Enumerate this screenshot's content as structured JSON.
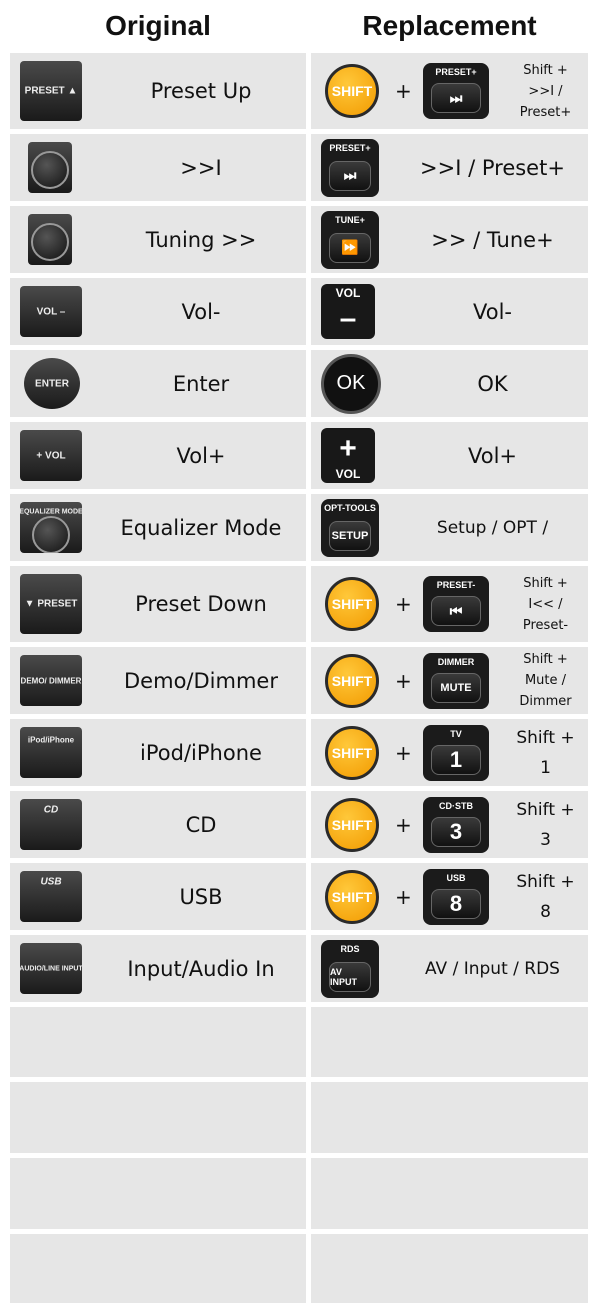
{
  "headers": {
    "original": "Original",
    "replacement": "Replacement"
  },
  "rows": [
    {
      "original": "Preset Up",
      "replacement": "Shift +\n>>I /\nPreset+",
      "shift": "SHIFT",
      "button_caption": "PRESET+",
      "button_face": "⏭",
      "orig_icon": "PRESET ▲"
    },
    {
      "original": ">>I",
      "replacement": ">>I / Preset+",
      "button_caption": "PRESET+",
      "button_face": "⏭",
      "orig_icon": "⏭"
    },
    {
      "original": "Tuning >>",
      "replacement": ">> / Tune+",
      "button_caption": "TUNE+",
      "button_face": "⏩",
      "orig_icon": "⏭"
    },
    {
      "original": "Vol-",
      "replacement": "Vol-",
      "button_caption": "VOL",
      "button_face": "–",
      "orig_icon": "VOL –"
    },
    {
      "original": "Enter",
      "replacement": "OK",
      "button_face": "OK",
      "orig_icon": "ENTER"
    },
    {
      "original": "Vol+",
      "replacement": "Vol+",
      "button_caption": "VOL",
      "button_face": "+",
      "orig_icon": "+ VOL"
    },
    {
      "original": "Equalizer Mode",
      "replacement": "Setup / OPT /",
      "button_caption": "OPT-TOOLS",
      "button_face": "SETUP",
      "orig_icon": "EQUALIZER MODE"
    },
    {
      "original": "Preset Down",
      "replacement": "Shift +\nI<< /\nPreset-",
      "shift": "SHIFT",
      "button_caption": "PRESET-",
      "button_face": "⏮",
      "orig_icon": "▼ PRESET"
    },
    {
      "original": "Demo/Dimmer",
      "replacement": "Shift +\nMute /\nDimmer",
      "shift": "SHIFT",
      "button_caption": "DIMMER",
      "button_face": "MUTE",
      "orig_icon": "DEMO/ DIMMER"
    },
    {
      "original": "iPod/iPhone",
      "replacement": "Shift +\n1",
      "shift": "SHIFT",
      "button_caption": "TV",
      "button_face": "1",
      "orig_icon": "iPod/iPhone"
    },
    {
      "original": "CD",
      "replacement": "Shift +\n3",
      "shift": "SHIFT",
      "button_caption": "CD·STB",
      "button_face": "3",
      "orig_icon": "CD"
    },
    {
      "original": "USB",
      "replacement": "Shift +\n8",
      "shift": "SHIFT",
      "button_caption": "USB",
      "button_face": "8",
      "orig_icon": "USB"
    },
    {
      "original": "Input/Audio In",
      "replacement": "AV / Input / RDS",
      "button_caption": "RDS",
      "button_face": "AV INPUT",
      "orig_icon": "AUDIO/LINE INPUT"
    }
  ],
  "plus_sign": "+",
  "empty_rows": 4
}
